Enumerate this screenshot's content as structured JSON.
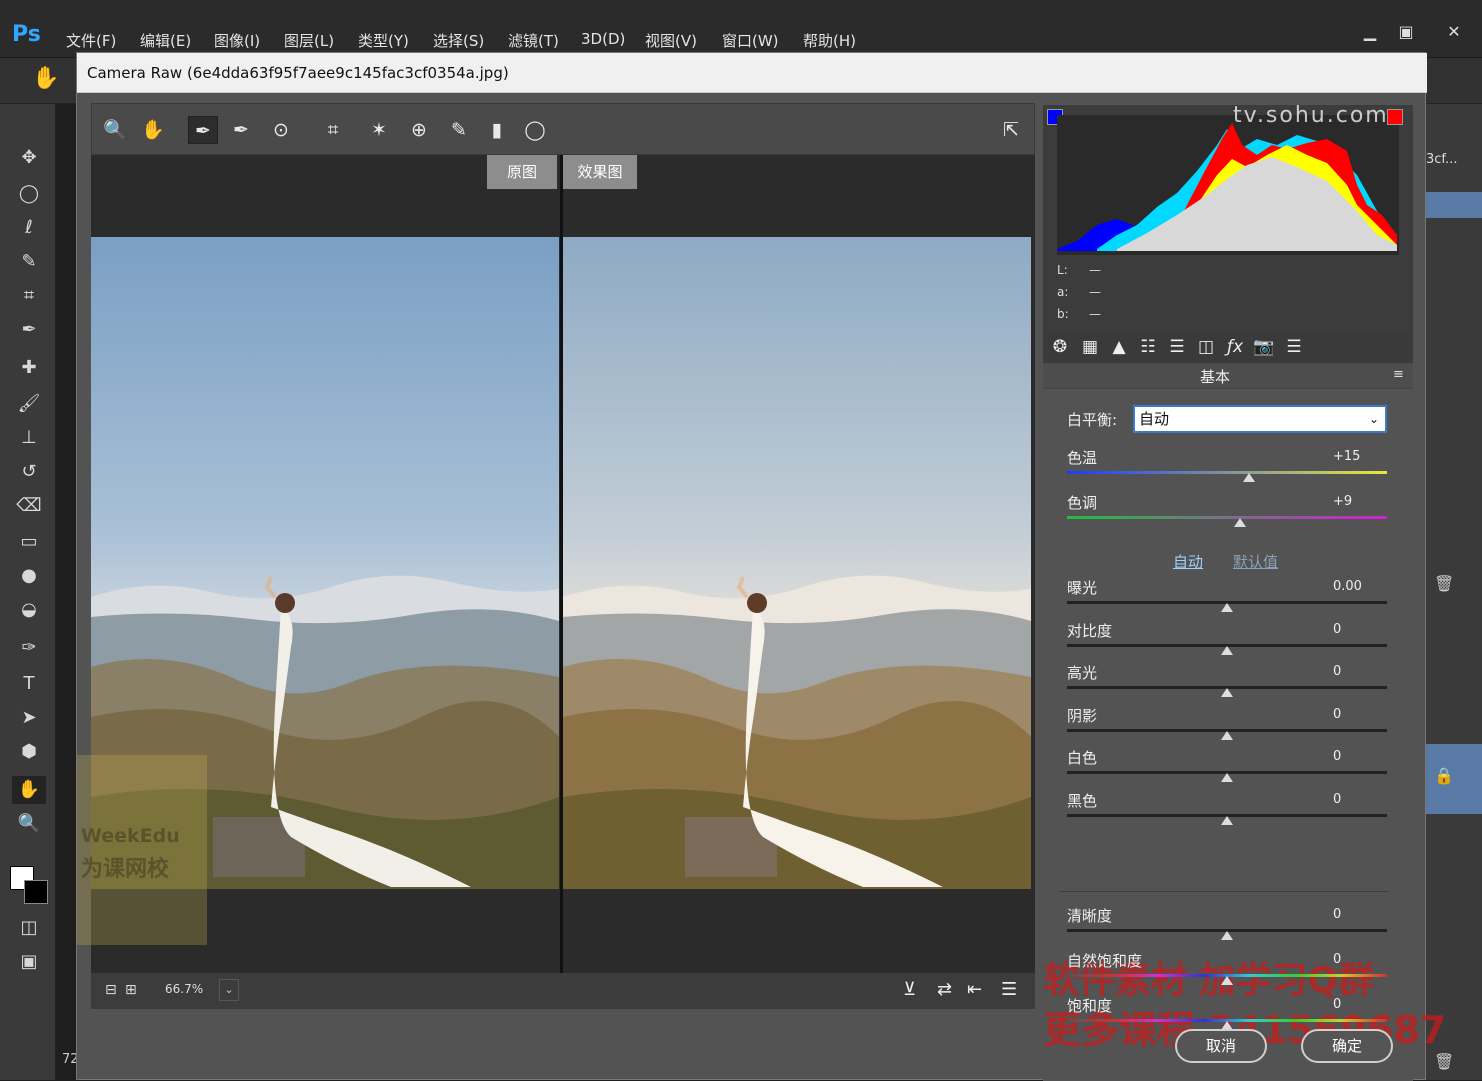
{
  "app": {
    "logo": "Ps"
  },
  "menu": [
    "文件(F)",
    "编辑(E)",
    "图像(I)",
    "图层(L)",
    "类型(Y)",
    "选择(S)",
    "滤镜(T)",
    "3D(D)",
    "视图(V)",
    "窗口(W)",
    "帮助(H)"
  ],
  "dialog": {
    "title": "Camera Raw (6e4dda63f95f7aee9c145fac3cf0354a.jpg)"
  },
  "preview": {
    "before_label": "原图",
    "after_label": "效果图"
  },
  "statusbar": {
    "zoom": "66.7%"
  },
  "histogram": {
    "lab_labels": [
      "L:",
      "a:",
      "b:"
    ],
    "lab_values": [
      "—",
      "—",
      "—"
    ]
  },
  "panel": {
    "title": "基本"
  },
  "white_balance": {
    "label": "白平衡:",
    "value": "自动"
  },
  "sliders_wb": [
    {
      "label": "色温",
      "value": "+15",
      "position": 0.57
    },
    {
      "label": "色调",
      "value": "+9",
      "position": 0.54
    }
  ],
  "links": {
    "auto": "自动",
    "default": "默认值"
  },
  "sliders_tone": [
    {
      "label": "曝光",
      "value": "0.00",
      "position": 0.5
    },
    {
      "label": "对比度",
      "value": "0",
      "position": 0.5
    },
    {
      "label": "高光",
      "value": "0",
      "position": 0.5
    },
    {
      "label": "阴影",
      "value": "0",
      "position": 0.5
    },
    {
      "label": "白色",
      "value": "0",
      "position": 0.5
    },
    {
      "label": "黑色",
      "value": "0",
      "position": 0.5
    }
  ],
  "sliders_presence": [
    {
      "label": "清晰度",
      "value": "0",
      "position": 0.5
    },
    {
      "label": "自然饱和度",
      "value": "0",
      "position": 0.5
    },
    {
      "label": "饱和度",
      "value": "0",
      "position": 0.5
    }
  ],
  "buttons": {
    "cancel": "取消",
    "ok": "确定"
  },
  "watermarks": {
    "sohu": "tv.sohu.com",
    "weekedu": "WeekEdu",
    "weekedu_cn": "为课网校",
    "promo_line1": "软件素材 加学习Q群",
    "promo_line2": "更多课程 241569687"
  },
  "side_text": {
    "ps_doc_tab": "3cf...",
    "ps_zoom": "72"
  }
}
